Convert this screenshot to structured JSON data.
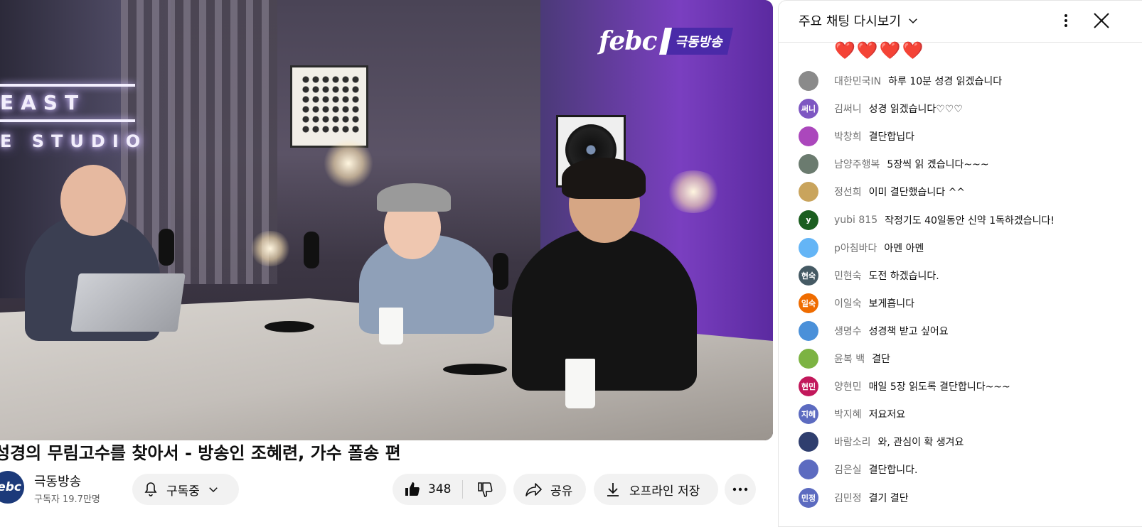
{
  "video": {
    "watermark_logo": "febc",
    "watermark_text": "극동방송",
    "neon_line1": "EAST",
    "neon_line2": "E STUDIO"
  },
  "title": "성경의 무림고수를 찾아서 - 방송인 조혜련, 가수 폴송 편",
  "channel": {
    "avatar_text": "ebc",
    "name": "극동방송",
    "subscribers": "구독자 19.7만명"
  },
  "actions": {
    "subscribe_label": "구독중",
    "like_count": "348",
    "share_label": "공유",
    "download_label": "오프라인 저장"
  },
  "chat": {
    "header_title": "주요 채팅 다시보기",
    "hearts": "❤️❤️❤️❤️",
    "messages": [
      {
        "author": "대한민국IN",
        "text": "하루 10분 성경 읽겠습니다",
        "avatar_text": "",
        "avatar_color": "#8a8a8a"
      },
      {
        "author": "김써니",
        "text": "성경 읽겠습니다♡♡♡",
        "avatar_text": "써니",
        "avatar_color": "#7e57c2"
      },
      {
        "author": "박창희",
        "text": "결단합닙다",
        "avatar_text": "",
        "avatar_color": "#ab47bc"
      },
      {
        "author": "남양주행복",
        "text": "5장씩 읽 겠습니다~~~",
        "avatar_text": "",
        "avatar_color": "#6b7b6f"
      },
      {
        "author": "정선희",
        "text": "이미 결단했습니다 ^^",
        "avatar_text": "",
        "avatar_color": "#c9a45c"
      },
      {
        "author": "yubi 815",
        "text": "작정기도 40일동안 신약 1독하겠습니다!",
        "avatar_text": "y",
        "avatar_color": "#1b5e20"
      },
      {
        "author": "p아침바다",
        "text": "아멘 아멘",
        "avatar_text": "",
        "avatar_color": "#64b5f6"
      },
      {
        "author": "민현숙",
        "text": "도전 하겠습니다.",
        "avatar_text": "현숙",
        "avatar_color": "#455a64"
      },
      {
        "author": "이일숙",
        "text": "보게흡니다",
        "avatar_text": "일숙",
        "avatar_color": "#ef6c00"
      },
      {
        "author": "생명수",
        "text": "성경책 받고 싶어요",
        "avatar_text": "",
        "avatar_color": "#4a90d9"
      },
      {
        "author": "윤복 백",
        "text": "결단",
        "avatar_text": "",
        "avatar_color": "#7cb342"
      },
      {
        "author": "양현민",
        "text": "매일 5장 읽도록 결단합니다~~~",
        "avatar_text": "현민",
        "avatar_color": "#c2185b"
      },
      {
        "author": "박지혜",
        "text": "저요저요",
        "avatar_text": "지혜",
        "avatar_color": "#5c6bc0"
      },
      {
        "author": "바람소리",
        "text": "와, 관심이 확 생겨요",
        "avatar_text": "",
        "avatar_color": "#2f3e6e"
      },
      {
        "author": "김은실",
        "text": "결단합니다.",
        "avatar_text": "",
        "avatar_color": "#5c6bc0"
      },
      {
        "author": "김민정",
        "text": "결기 결단",
        "avatar_text": "민정",
        "avatar_color": "#5c6bc0"
      }
    ]
  }
}
